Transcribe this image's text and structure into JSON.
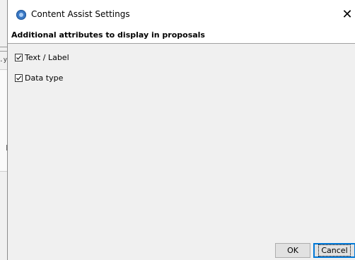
{
  "dialog": {
    "title": "Content Assist Settings",
    "close_glyph": "✕",
    "section_title": "Additional attributes to display in proposals",
    "options": [
      {
        "label": "Text / Label",
        "checked": true
      },
      {
        "label": "Data type",
        "checked": true
      }
    ],
    "buttons": {
      "ok_label": "OK",
      "cancel_label": "Cancel"
    }
  },
  "background": {
    "partial_text": "y."
  },
  "icons": {
    "title": "app-info-icon",
    "close": "close-icon",
    "check": "checkmark-icon"
  },
  "colors": {
    "dialog_bg": "#f0f0f0",
    "title_bg": "#ffffff",
    "focus_border": "#0078d7"
  }
}
